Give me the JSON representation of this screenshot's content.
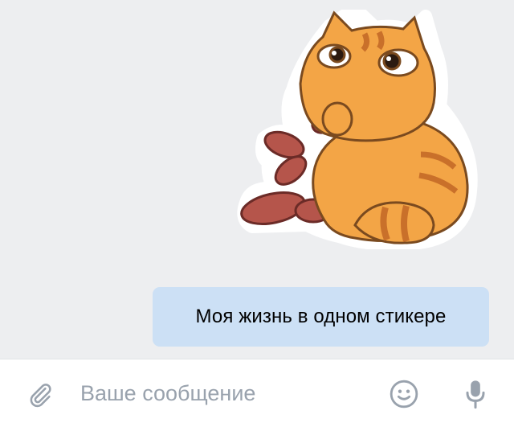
{
  "conversation": {
    "sticker": {
      "description": "orange cat sticker eating sausages"
    },
    "outgoing_message": {
      "text": "Моя жизнь в одном стикере"
    }
  },
  "composer": {
    "placeholder": "Ваше сообщение",
    "value": "",
    "icons": {
      "attach": "paperclip-icon",
      "emoji": "smiley-icon",
      "voice": "microphone-icon"
    }
  },
  "colors": {
    "background": "#edeef0",
    "outgoing_bubble": "#cce0f5",
    "icon": "#99a2ad",
    "composer_bg": "#ffffff"
  }
}
